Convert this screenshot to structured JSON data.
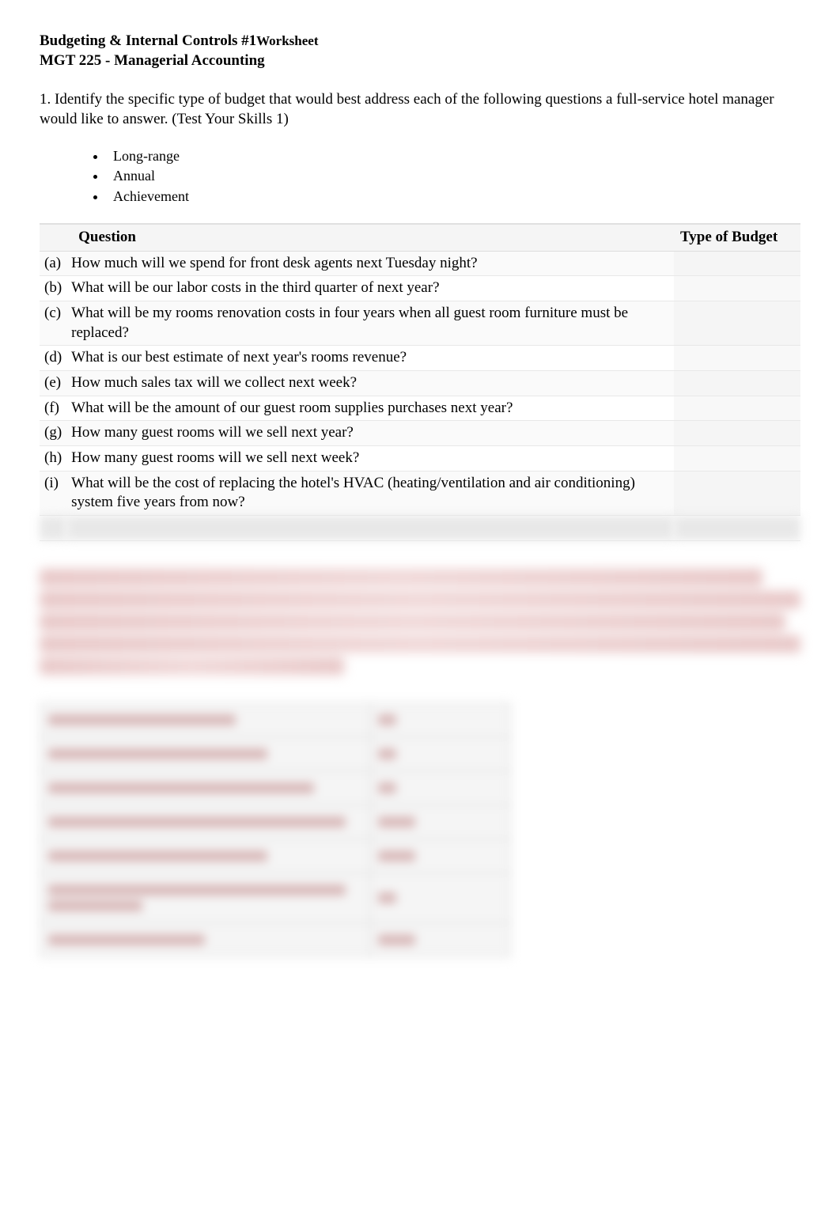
{
  "header": {
    "title": "Budgeting & Internal Controls #1",
    "worksheet": "Worksheet",
    "subtitle": "MGT 225 - Managerial Accounting"
  },
  "intro": "1. Identify the specific type of budget that would best address each of the following questions a full-service hotel manager would like to answer. (Test Your Skills 1)",
  "bullets": [
    "Long-range",
    "Annual",
    "Achievement"
  ],
  "table": {
    "header_question": "Question",
    "header_type": "Type of Budget",
    "rows": [
      {
        "label": "(a)",
        "text": "How much will we spend for front desk agents next Tuesday night?",
        "answer": ""
      },
      {
        "label": "(b)",
        "text": "What will be our labor costs in the third quarter of next year?",
        "answer": ""
      },
      {
        "label": "(c)",
        "text": "What will be my rooms renovation costs in four years when all guest room furniture must be replaced?",
        "answer": ""
      },
      {
        "label": "(d)",
        "text": "What is our best estimate of next year's rooms revenue?",
        "answer": ""
      },
      {
        "label": "(e)",
        "text": "How much sales tax will we collect next week?",
        "answer": ""
      },
      {
        "label": "(f)",
        "text": "What will be the amount of our guest room supplies purchases next year?",
        "answer": ""
      },
      {
        "label": "(g)",
        "text": "How many guest rooms will we sell next year?",
        "answer": ""
      },
      {
        "label": "(h)",
        "text": "How many guest rooms will we sell next week?",
        "answer": ""
      },
      {
        "label": "(i)",
        "text": " What will be the cost of replacing the hotel's HVAC (heating/ventilation and air conditioning) system five years from now?",
        "answer": ""
      }
    ]
  }
}
